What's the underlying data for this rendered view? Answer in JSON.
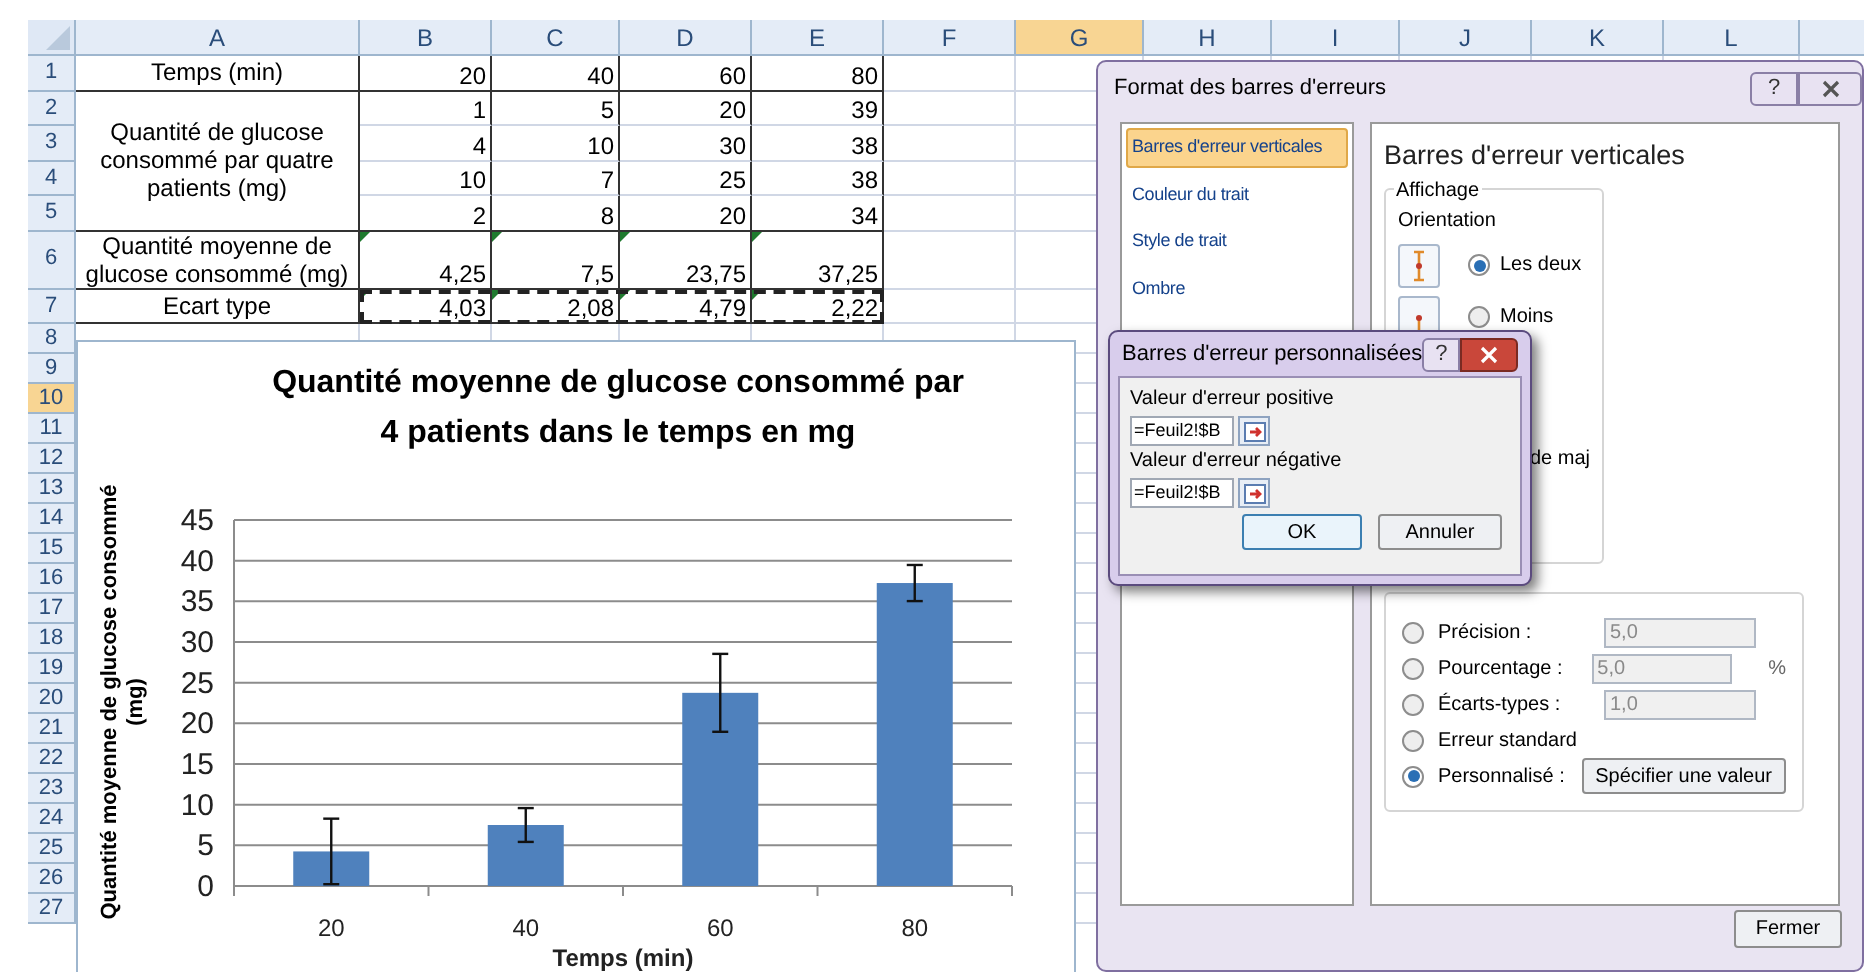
{
  "sheet": {
    "columns": [
      {
        "label": "A",
        "selected": false
      },
      {
        "label": "B",
        "selected": false
      },
      {
        "label": "C",
        "selected": false
      },
      {
        "label": "D",
        "selected": false
      },
      {
        "label": "E",
        "selected": false
      },
      {
        "label": "F",
        "selected": false
      },
      {
        "label": "G",
        "selected": true
      },
      {
        "label": "H",
        "selected": false
      },
      {
        "label": "I",
        "selected": false
      },
      {
        "label": "J",
        "selected": false
      },
      {
        "label": "K",
        "selected": false
      },
      {
        "label": "L",
        "selected": false
      }
    ],
    "rows": [
      {
        "label": "1",
        "selected": false
      },
      {
        "label": "2",
        "selected": false
      },
      {
        "label": "3",
        "selected": false
      },
      {
        "label": "4",
        "selected": false
      },
      {
        "label": "5",
        "selected": false
      },
      {
        "label": "6",
        "selected": false
      },
      {
        "label": "7",
        "selected": false
      },
      {
        "label": "8",
        "selected": false
      },
      {
        "label": "9",
        "selected": false
      },
      {
        "label": "10",
        "selected": true
      },
      {
        "label": "11",
        "selected": false
      },
      {
        "label": "12",
        "selected": false
      },
      {
        "label": "13",
        "selected": false
      },
      {
        "label": "14",
        "selected": false
      },
      {
        "label": "15",
        "selected": false
      },
      {
        "label": "16",
        "selected": false
      },
      {
        "label": "17",
        "selected": false
      },
      {
        "label": "18",
        "selected": false
      },
      {
        "label": "19",
        "selected": false
      },
      {
        "label": "20",
        "selected": false
      },
      {
        "label": "21",
        "selected": false
      },
      {
        "label": "22",
        "selected": false
      },
      {
        "label": "23",
        "selected": false
      },
      {
        "label": "24",
        "selected": false
      },
      {
        "label": "25",
        "selected": false
      },
      {
        "label": "26",
        "selected": false
      },
      {
        "label": "27",
        "selected": false
      }
    ],
    "table": [
      {
        "label": "Temps (min)",
        "rows": [
          [
            "20",
            "40",
            "60",
            "80"
          ]
        ]
      },
      {
        "label": "Quantité de glucose consommé par quatre patients (mg)",
        "rows": [
          [
            "1",
            "5",
            "20",
            "39"
          ],
          [
            "4",
            "10",
            "30",
            "38"
          ],
          [
            "10",
            "7",
            "25",
            "38"
          ],
          [
            "2",
            "8",
            "20",
            "34"
          ]
        ]
      },
      {
        "label": "Quantité moyenne de glucose consommé (mg)",
        "rows": [
          [
            "4,25",
            "7,5",
            "23,75",
            "37,25"
          ]
        ],
        "flagged": true
      },
      {
        "label": "Ecart type",
        "rows": [
          [
            "4,03",
            "2,08",
            "4,79",
            "2,22"
          ]
        ],
        "flagged": true,
        "marquee": true
      }
    ]
  },
  "chart": {
    "chart_data": {
      "type": "bar",
      "title": "Quantité moyenne de glucose consommé  par\n4 patients dans le temps en mg",
      "xlabel": "Temps (min)",
      "ylabel": "Quantité moyenne de glucose consommé\n(mg)",
      "categories": [
        "20",
        "40",
        "60",
        "80"
      ],
      "series": [
        {
          "color": "#4f81bd",
          "values": [
            4.25,
            7.5,
            23.75,
            37.25
          ]
        }
      ],
      "ylim": [
        0,
        45
      ],
      "yticks": [
        0,
        5,
        10,
        15,
        20,
        25,
        30,
        35,
        40,
        45
      ],
      "grid": true
    }
  },
  "format_dialog": {
    "title": "Format des barres d'erreurs",
    "help": "?",
    "categories": [
      {
        "label": "Barres d'erreur verticales",
        "selected": true
      },
      {
        "label": "Couleur du trait",
        "selected": false
      },
      {
        "label": "Style de trait",
        "selected": false
      },
      {
        "label": "Ombre",
        "selected": false
      }
    ],
    "heading": "Barres d'erreur verticales",
    "display_group": {
      "title": "Affichage",
      "orientation_label": "Orientation",
      "options": [
        {
          "label": "Les deux",
          "selected": true
        },
        {
          "label": "Moins",
          "selected": false
        }
      ],
      "partial_text": "de maj"
    },
    "amount_options": [
      {
        "kind": "field",
        "label": "Précision :",
        "selected": false,
        "value": "5,0",
        "disabled": true
      },
      {
        "kind": "field",
        "label": "Pourcentage :",
        "selected": false,
        "value": "5,0",
        "disabled": true,
        "unit": "%"
      },
      {
        "kind": "field",
        "label": "Écarts-types :",
        "selected": false,
        "value": "1,0",
        "disabled": true
      },
      {
        "kind": "plain",
        "label": "Erreur standard",
        "selected": false
      },
      {
        "kind": "button",
        "label": "Personnalisé :",
        "selected": true,
        "button": "Spécifier une valeur"
      }
    ],
    "close_button": "Fermer"
  },
  "custom_dialog": {
    "title": "Barres d'erreur personnalisées",
    "help": "?",
    "fields": [
      {
        "label": "Valeur d'erreur positive",
        "value": "=Feuil2!$B"
      },
      {
        "label": "Valeur d'erreur négative",
        "value": "=Feuil2!$B"
      }
    ],
    "ok_button": "OK",
    "cancel_button": "Annuler"
  }
}
